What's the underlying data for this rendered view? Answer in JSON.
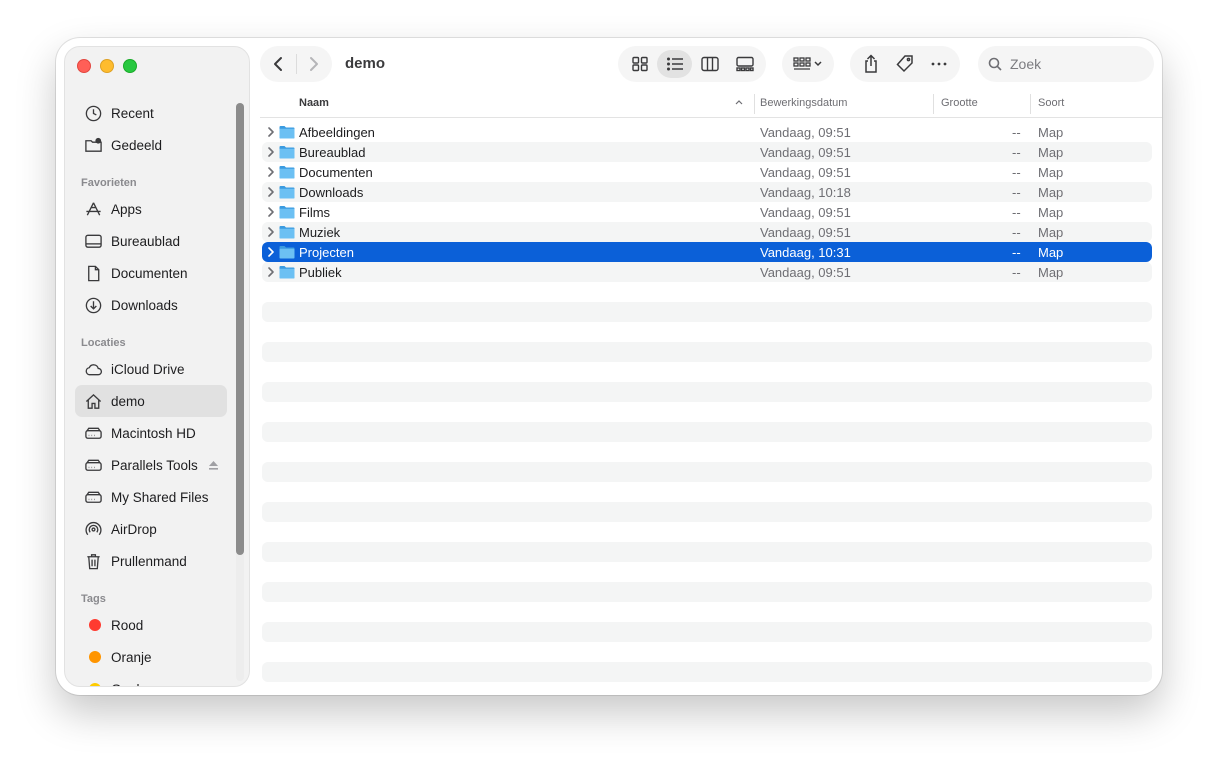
{
  "window": {
    "title": "demo"
  },
  "sidebar": {
    "top_items": [
      {
        "label": "Recent",
        "icon": "clock-icon"
      },
      {
        "label": "Gedeeld",
        "icon": "shared-folder-icon"
      }
    ],
    "sections": [
      {
        "header": "Favorieten",
        "items": [
          {
            "label": "Apps",
            "icon": "apps-icon"
          },
          {
            "label": "Bureaublad",
            "icon": "desktop-icon"
          },
          {
            "label": "Documenten",
            "icon": "document-icon"
          },
          {
            "label": "Downloads",
            "icon": "download-icon"
          }
        ]
      },
      {
        "header": "Locaties",
        "items": [
          {
            "label": "iCloud Drive",
            "icon": "cloud-icon"
          },
          {
            "label": "demo",
            "icon": "home-icon",
            "active": true
          },
          {
            "label": "Macintosh HD",
            "icon": "disk-icon"
          },
          {
            "label": "Parallels Tools",
            "icon": "disk-icon",
            "eject": true
          },
          {
            "label": "My Shared Files",
            "icon": "disk-icon"
          },
          {
            "label": "AirDrop",
            "icon": "airdrop-icon"
          },
          {
            "label": "Prullenmand",
            "icon": "trash-icon"
          }
        ]
      },
      {
        "header": "Tags",
        "items": [
          {
            "label": "Rood",
            "color": "#ff3b30"
          },
          {
            "label": "Oranje",
            "color": "#ff9500"
          },
          {
            "label": "Geel",
            "color": "#ffcc00"
          }
        ]
      }
    ]
  },
  "toolbar": {
    "search_placeholder": "Zoek"
  },
  "columns": {
    "name": "Naam",
    "date": "Bewerkingsdatum",
    "size": "Grootte",
    "kind": "Soort"
  },
  "files": [
    {
      "name": "Afbeeldingen",
      "date": "Vandaag, 09:51",
      "size": "--",
      "kind": "Map",
      "selected": false
    },
    {
      "name": "Bureaublad",
      "date": "Vandaag, 09:51",
      "size": "--",
      "kind": "Map",
      "selected": false
    },
    {
      "name": "Documenten",
      "date": "Vandaag, 09:51",
      "size": "--",
      "kind": "Map",
      "selected": false
    },
    {
      "name": "Downloads",
      "date": "Vandaag, 10:18",
      "size": "--",
      "kind": "Map",
      "selected": false
    },
    {
      "name": "Films",
      "date": "Vandaag, 09:51",
      "size": "--",
      "kind": "Map",
      "selected": false
    },
    {
      "name": "Muziek",
      "date": "Vandaag, 09:51",
      "size": "--",
      "kind": "Map",
      "selected": false
    },
    {
      "name": "Projecten",
      "date": "Vandaag, 10:31",
      "size": "--",
      "kind": "Map",
      "selected": true
    },
    {
      "name": "Publiek",
      "date": "Vandaag, 09:51",
      "size": "--",
      "kind": "Map",
      "selected": false
    }
  ],
  "colors": {
    "selection": "#0b60d8",
    "folder": "#5ab1ee"
  }
}
